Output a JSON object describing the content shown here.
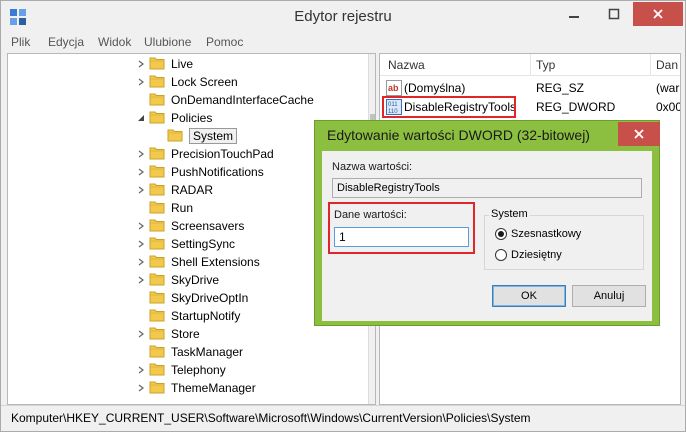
{
  "window": {
    "title": "Edytor rejestru"
  },
  "menu": [
    "Plik",
    "Edycja",
    "Widok",
    "Ulubione",
    "Pomoc"
  ],
  "tree": {
    "items": [
      {
        "label": "Live",
        "expandable": true
      },
      {
        "label": "Lock Screen",
        "expandable": true
      },
      {
        "label": "OnDemandInterfaceCache",
        "expandable": false
      },
      {
        "label": "Policies",
        "expandable": true,
        "expanded": true
      },
      {
        "label": "System",
        "expandable": false,
        "selected": true,
        "child": true
      },
      {
        "label": "PrecisionTouchPad",
        "expandable": true
      },
      {
        "label": "PushNotifications",
        "expandable": true
      },
      {
        "label": "RADAR",
        "expandable": true
      },
      {
        "label": "Run",
        "expandable": false
      },
      {
        "label": "Screensavers",
        "expandable": true
      },
      {
        "label": "SettingSync",
        "expandable": true
      },
      {
        "label": "Shell Extensions",
        "expandable": true
      },
      {
        "label": "SkyDrive",
        "expandable": true
      },
      {
        "label": "SkyDriveOptIn",
        "expandable": false
      },
      {
        "label": "StartupNotify",
        "expandable": false
      },
      {
        "label": "Store",
        "expandable": true
      },
      {
        "label": "TaskManager",
        "expandable": false
      },
      {
        "label": "Telephony",
        "expandable": true
      },
      {
        "label": "ThemeManager",
        "expandable": true
      }
    ]
  },
  "list": {
    "columns": [
      "Nazwa",
      "Typ",
      "Dan"
    ],
    "rows": [
      {
        "name": "(Domyślna)",
        "type": "REG_SZ",
        "data": "(war",
        "icon": "string-value-icon"
      },
      {
        "name": "DisableRegistryTools",
        "type": "REG_DWORD",
        "data": "0x00",
        "icon": "dword-value-icon"
      }
    ]
  },
  "status": {
    "path": "Komputer\\HKEY_CURRENT_USER\\Software\\Microsoft\\Windows\\CurrentVersion\\Policies\\System"
  },
  "dialog": {
    "title": "Edytowanie wartości DWORD (32-bitowej)",
    "name_label": "Nazwa wartości:",
    "name_value": "DisableRegistryTools",
    "data_label": "Dane wartości:",
    "data_value": "1",
    "base_group": "System",
    "base_options": [
      "Szesnastkowy",
      "Dziesiętny"
    ],
    "base_selected": "Szesnastkowy",
    "ok_label": "OK",
    "cancel_label": "Anuluj"
  },
  "colors": {
    "dialog_frame": "#8cbf40",
    "highlight": "#e0262b",
    "close_button": "#c7504b"
  }
}
